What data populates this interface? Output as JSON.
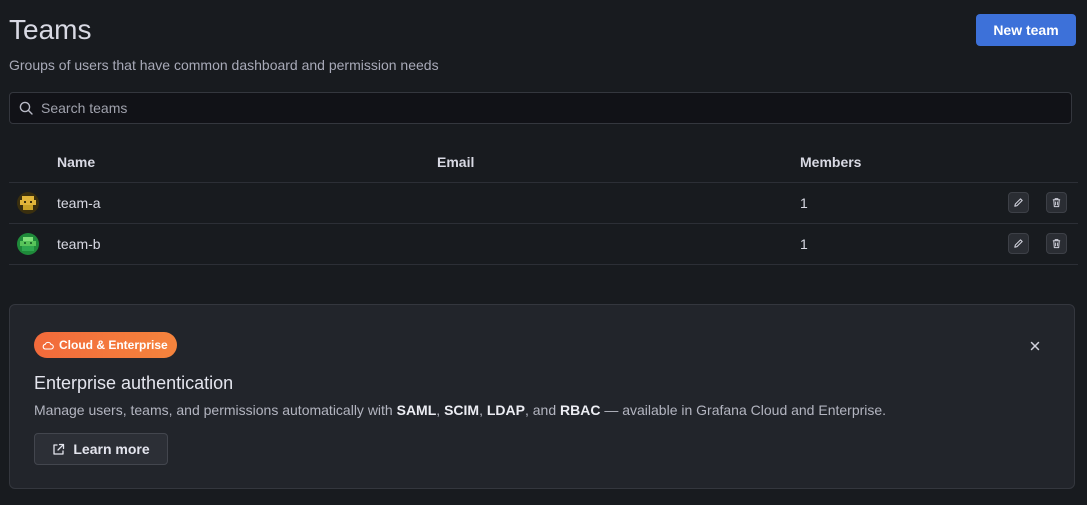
{
  "header": {
    "title": "Teams",
    "subtitle": "Groups of users that have common dashboard and permission needs",
    "new_team_label": "New team"
  },
  "search": {
    "placeholder": "Search teams",
    "value": ""
  },
  "table": {
    "columns": {
      "name": "Name",
      "email": "Email",
      "members": "Members"
    },
    "rows": [
      {
        "name": "team-a",
        "email": "",
        "members": "1",
        "avatar_color": "#c9a227"
      },
      {
        "name": "team-b",
        "email": "",
        "members": "1",
        "avatar_color": "#2fa84f"
      }
    ]
  },
  "banner": {
    "badge_label": "Cloud & Enterprise",
    "title": "Enterprise authentication",
    "text_start": "Manage users, teams, and permissions automatically with ",
    "kw_saml": "SAML",
    "sep1": ", ",
    "kw_scim": "SCIM",
    "sep2": ", ",
    "kw_ldap": "LDAP",
    "sep3": ", and ",
    "kw_rbac": "RBAC",
    "text_end": " — available in Grafana Cloud and Enterprise.",
    "learn_more_label": "Learn more"
  },
  "colors": {
    "background": "#181b1f",
    "primary": "#3d71d9",
    "badge_gradient_start": "#f26a3b",
    "badge_gradient_end": "#f5843d"
  },
  "icons": {
    "search": "search-icon",
    "edit": "pencil-icon",
    "delete": "trash-icon",
    "close": "close-icon",
    "cloud": "cloud-icon",
    "external": "external-link-icon"
  }
}
